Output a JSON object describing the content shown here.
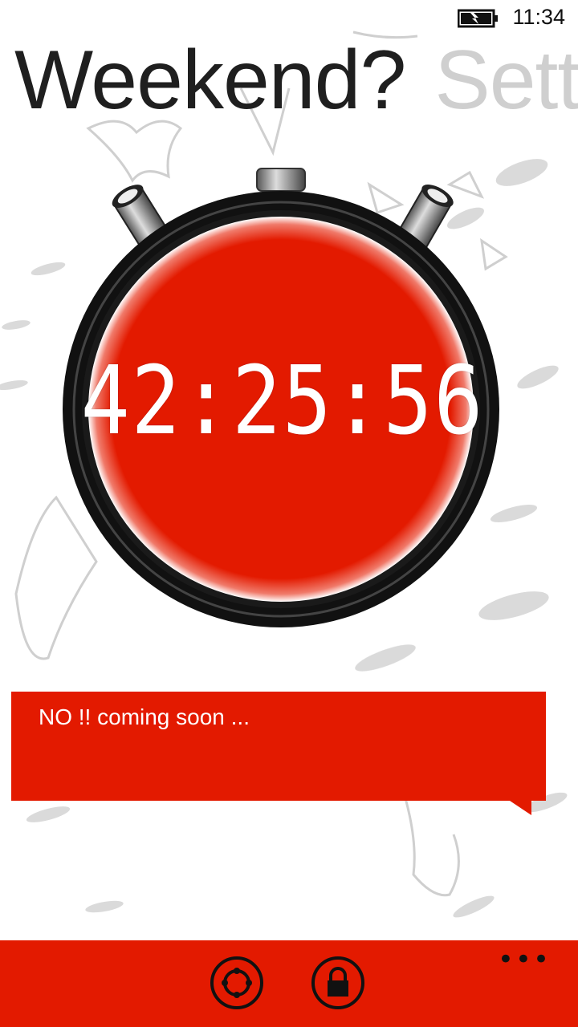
{
  "status_bar": {
    "time": "11:34",
    "battery_icon": "battery-charging-icon"
  },
  "pivot": {
    "items": [
      {
        "label": "Weekend?",
        "active": true
      },
      {
        "label": "Settings",
        "active": false
      }
    ]
  },
  "stopwatch": {
    "countdown": "42:25:56"
  },
  "message": {
    "text": "NO !! coming soon ..."
  },
  "app_bar": {
    "buttons": [
      {
        "icon": "refresh-icon"
      },
      {
        "icon": "lock-icon"
      }
    ],
    "more_label": "•••"
  },
  "colors": {
    "accent": "#e31a00",
    "title": "#1f1f1f",
    "inactive_title": "#cfcfcf"
  }
}
